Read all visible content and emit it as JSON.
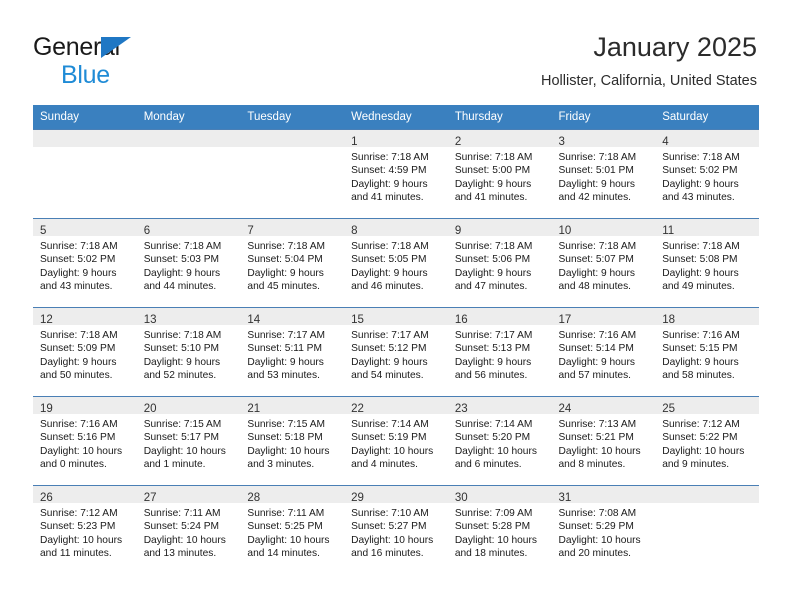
{
  "brand": {
    "name_top": "General",
    "name_bottom": "Blue",
    "triangle_color": "#1f77c4",
    "bottom_color": "#1f8bd6"
  },
  "header": {
    "month_title": "January 2025",
    "location": "Hollister, California, United States"
  },
  "theme": {
    "header_bg": "#3a80bf",
    "header_text": "#ffffff",
    "daynum_bar_bg": "#ededed",
    "grid_line": "#4a7fb5",
    "cell_bg": "#ffffff"
  },
  "weekday_headers": [
    "Sunday",
    "Monday",
    "Tuesday",
    "Wednesday",
    "Thursday",
    "Friday",
    "Saturday"
  ],
  "labels": {
    "sunrise_prefix": "Sunrise:",
    "sunset_prefix": "Sunset:",
    "daylight_prefix": "Daylight:"
  },
  "weeks": [
    [
      {
        "day": "",
        "empty": true,
        "line1": "",
        "line2": "",
        "line3": "",
        "line4": ""
      },
      {
        "day": "",
        "empty": true,
        "line1": "",
        "line2": "",
        "line3": "",
        "line4": ""
      },
      {
        "day": "",
        "empty": true,
        "line1": "",
        "line2": "",
        "line3": "",
        "line4": ""
      },
      {
        "day": "1",
        "empty": false,
        "line1": "Sunrise: 7:18 AM",
        "line2": "Sunset: 4:59 PM",
        "line3": "Daylight: 9 hours",
        "line4": "and 41 minutes."
      },
      {
        "day": "2",
        "empty": false,
        "line1": "Sunrise: 7:18 AM",
        "line2": "Sunset: 5:00 PM",
        "line3": "Daylight: 9 hours",
        "line4": "and 41 minutes."
      },
      {
        "day": "3",
        "empty": false,
        "line1": "Sunrise: 7:18 AM",
        "line2": "Sunset: 5:01 PM",
        "line3": "Daylight: 9 hours",
        "line4": "and 42 minutes."
      },
      {
        "day": "4",
        "empty": false,
        "line1": "Sunrise: 7:18 AM",
        "line2": "Sunset: 5:02 PM",
        "line3": "Daylight: 9 hours",
        "line4": "and 43 minutes."
      }
    ],
    [
      {
        "day": "5",
        "empty": false,
        "line1": "Sunrise: 7:18 AM",
        "line2": "Sunset: 5:02 PM",
        "line3": "Daylight: 9 hours",
        "line4": "and 43 minutes."
      },
      {
        "day": "6",
        "empty": false,
        "line1": "Sunrise: 7:18 AM",
        "line2": "Sunset: 5:03 PM",
        "line3": "Daylight: 9 hours",
        "line4": "and 44 minutes."
      },
      {
        "day": "7",
        "empty": false,
        "line1": "Sunrise: 7:18 AM",
        "line2": "Sunset: 5:04 PM",
        "line3": "Daylight: 9 hours",
        "line4": "and 45 minutes."
      },
      {
        "day": "8",
        "empty": false,
        "line1": "Sunrise: 7:18 AM",
        "line2": "Sunset: 5:05 PM",
        "line3": "Daylight: 9 hours",
        "line4": "and 46 minutes."
      },
      {
        "day": "9",
        "empty": false,
        "line1": "Sunrise: 7:18 AM",
        "line2": "Sunset: 5:06 PM",
        "line3": "Daylight: 9 hours",
        "line4": "and 47 minutes."
      },
      {
        "day": "10",
        "empty": false,
        "line1": "Sunrise: 7:18 AM",
        "line2": "Sunset: 5:07 PM",
        "line3": "Daylight: 9 hours",
        "line4": "and 48 minutes."
      },
      {
        "day": "11",
        "empty": false,
        "line1": "Sunrise: 7:18 AM",
        "line2": "Sunset: 5:08 PM",
        "line3": "Daylight: 9 hours",
        "line4": "and 49 minutes."
      }
    ],
    [
      {
        "day": "12",
        "empty": false,
        "line1": "Sunrise: 7:18 AM",
        "line2": "Sunset: 5:09 PM",
        "line3": "Daylight: 9 hours",
        "line4": "and 50 minutes."
      },
      {
        "day": "13",
        "empty": false,
        "line1": "Sunrise: 7:18 AM",
        "line2": "Sunset: 5:10 PM",
        "line3": "Daylight: 9 hours",
        "line4": "and 52 minutes."
      },
      {
        "day": "14",
        "empty": false,
        "line1": "Sunrise: 7:17 AM",
        "line2": "Sunset: 5:11 PM",
        "line3": "Daylight: 9 hours",
        "line4": "and 53 minutes."
      },
      {
        "day": "15",
        "empty": false,
        "line1": "Sunrise: 7:17 AM",
        "line2": "Sunset: 5:12 PM",
        "line3": "Daylight: 9 hours",
        "line4": "and 54 minutes."
      },
      {
        "day": "16",
        "empty": false,
        "line1": "Sunrise: 7:17 AM",
        "line2": "Sunset: 5:13 PM",
        "line3": "Daylight: 9 hours",
        "line4": "and 56 minutes."
      },
      {
        "day": "17",
        "empty": false,
        "line1": "Sunrise: 7:16 AM",
        "line2": "Sunset: 5:14 PM",
        "line3": "Daylight: 9 hours",
        "line4": "and 57 minutes."
      },
      {
        "day": "18",
        "empty": false,
        "line1": "Sunrise: 7:16 AM",
        "line2": "Sunset: 5:15 PM",
        "line3": "Daylight: 9 hours",
        "line4": "and 58 minutes."
      }
    ],
    [
      {
        "day": "19",
        "empty": false,
        "line1": "Sunrise: 7:16 AM",
        "line2": "Sunset: 5:16 PM",
        "line3": "Daylight: 10 hours",
        "line4": "and 0 minutes."
      },
      {
        "day": "20",
        "empty": false,
        "line1": "Sunrise: 7:15 AM",
        "line2": "Sunset: 5:17 PM",
        "line3": "Daylight: 10 hours",
        "line4": "and 1 minute."
      },
      {
        "day": "21",
        "empty": false,
        "line1": "Sunrise: 7:15 AM",
        "line2": "Sunset: 5:18 PM",
        "line3": "Daylight: 10 hours",
        "line4": "and 3 minutes."
      },
      {
        "day": "22",
        "empty": false,
        "line1": "Sunrise: 7:14 AM",
        "line2": "Sunset: 5:19 PM",
        "line3": "Daylight: 10 hours",
        "line4": "and 4 minutes."
      },
      {
        "day": "23",
        "empty": false,
        "line1": "Sunrise: 7:14 AM",
        "line2": "Sunset: 5:20 PM",
        "line3": "Daylight: 10 hours",
        "line4": "and 6 minutes."
      },
      {
        "day": "24",
        "empty": false,
        "line1": "Sunrise: 7:13 AM",
        "line2": "Sunset: 5:21 PM",
        "line3": "Daylight: 10 hours",
        "line4": "and 8 minutes."
      },
      {
        "day": "25",
        "empty": false,
        "line1": "Sunrise: 7:12 AM",
        "line2": "Sunset: 5:22 PM",
        "line3": "Daylight: 10 hours",
        "line4": "and 9 minutes."
      }
    ],
    [
      {
        "day": "26",
        "empty": false,
        "line1": "Sunrise: 7:12 AM",
        "line2": "Sunset: 5:23 PM",
        "line3": "Daylight: 10 hours",
        "line4": "and 11 minutes."
      },
      {
        "day": "27",
        "empty": false,
        "line1": "Sunrise: 7:11 AM",
        "line2": "Sunset: 5:24 PM",
        "line3": "Daylight: 10 hours",
        "line4": "and 13 minutes."
      },
      {
        "day": "28",
        "empty": false,
        "line1": "Sunrise: 7:11 AM",
        "line2": "Sunset: 5:25 PM",
        "line3": "Daylight: 10 hours",
        "line4": "and 14 minutes."
      },
      {
        "day": "29",
        "empty": false,
        "line1": "Sunrise: 7:10 AM",
        "line2": "Sunset: 5:27 PM",
        "line3": "Daylight: 10 hours",
        "line4": "and 16 minutes."
      },
      {
        "day": "30",
        "empty": false,
        "line1": "Sunrise: 7:09 AM",
        "line2": "Sunset: 5:28 PM",
        "line3": "Daylight: 10 hours",
        "line4": "and 18 minutes."
      },
      {
        "day": "31",
        "empty": false,
        "line1": "Sunrise: 7:08 AM",
        "line2": "Sunset: 5:29 PM",
        "line3": "Daylight: 10 hours",
        "line4": "and 20 minutes."
      },
      {
        "day": "",
        "empty": true,
        "line1": "",
        "line2": "",
        "line3": "",
        "line4": ""
      }
    ]
  ]
}
